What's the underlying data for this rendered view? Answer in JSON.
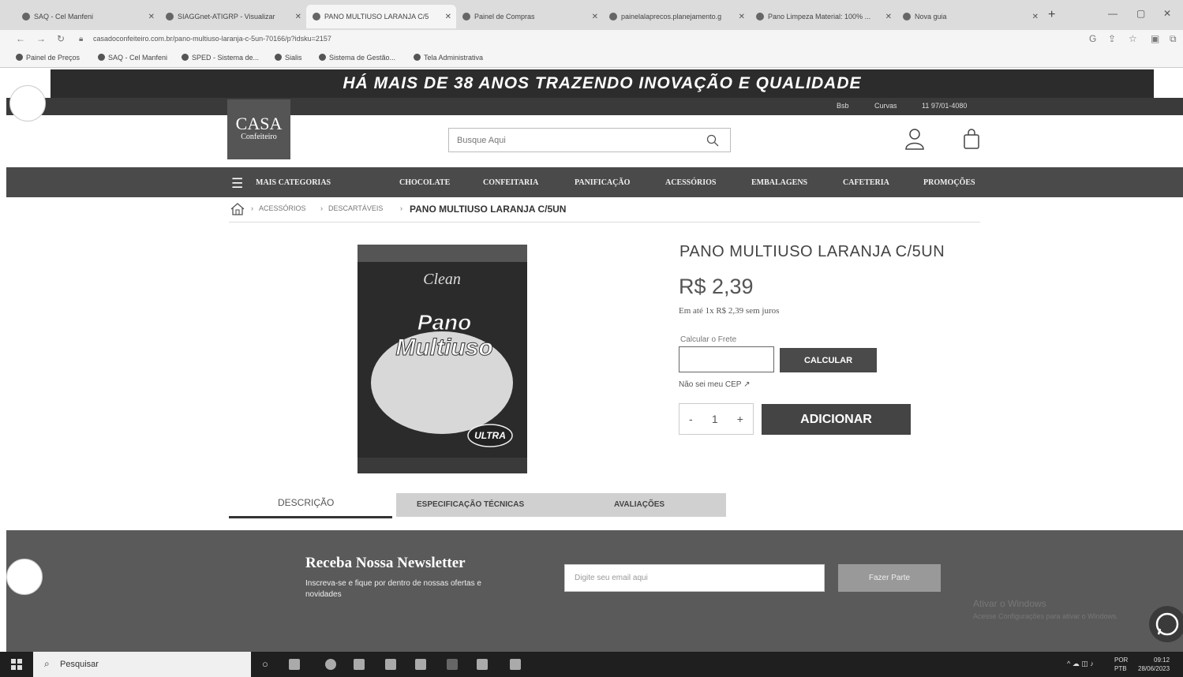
{
  "browser": {
    "tabs": [
      {
        "label": "SAQ - Cel Manfeni",
        "active": false
      },
      {
        "label": "SIAGGnet-ATIGRP - Visualizar",
        "active": false
      },
      {
        "label": "PANO MULTIUSO LARANJA C/5",
        "active": true
      },
      {
        "label": "Painel de Compras",
        "active": false
      },
      {
        "label": "painelalaprecos.planejamento.g",
        "active": false
      },
      {
        "label": "Pano Limpeza Material: 100% ...",
        "active": false
      },
      {
        "label": "Nova guia",
        "active": false
      }
    ],
    "url": "casadoconfeiteiro.com.br/pano-multiuso-laranja-c-5un-70166/p?idsku=2157",
    "bookmarks": [
      "Painel de Preços",
      "SAQ - Cel Manfeni",
      "SPED - Sistema de...",
      "Sialis",
      "Sistema de Gestão...",
      "Tela Administrativa"
    ]
  },
  "site": {
    "banner": "HÁ MAIS DE 38 ANOS TRAZENDO INOVAÇÃO E QUALIDADE",
    "contact": {
      "item1": "Bsb",
      "item2": "Curvas",
      "phone": "11 97/01-4080"
    },
    "logo": {
      "line1": "CASA",
      "line2": "Confeiteiro"
    },
    "search_placeholder": "Busque Aqui",
    "nav": [
      "MAIS CATEGORIAS",
      "CHOCOLATE",
      "CONFEITARIA",
      "PANIFICAÇÃO",
      "ACESSÓRIOS",
      "EMBALAGENS",
      "CAFETERIA",
      "PROMOÇÕES"
    ],
    "breadcrumb": [
      "ACESSÓRIOS",
      "DESCARTÁVEIS",
      "PANO MULTIUSO LARANJA C/5UN"
    ]
  },
  "product": {
    "title": "PANO MULTIUSO LARANJA C/5UN",
    "price": "R$ 2,39",
    "installments": "Em até 1x R$ 2,39 sem juros",
    "freight_label": "Calcular o Frete",
    "calc_button": "CALCULAR",
    "no_cep": "Não sei meu CEP",
    "quantity": "1",
    "qty_minus": "-",
    "qty_plus": "+",
    "add_button": "ADICIONAR",
    "image": {
      "brand": "Clean",
      "name_line1": "Pano",
      "name_line2": "Multiuso",
      "badge": "ULTRA"
    }
  },
  "tabs": [
    "DESCRIÇÃO",
    "ESPECIFICAÇÃO TÉCNICAS",
    "AVALIAÇÕES"
  ],
  "newsletter": {
    "title": "Receba Nossa Newsletter",
    "subtitle": "Inscreva-se e fique por dentro de nossas ofertas e novidades",
    "email_placeholder": "Digite seu email aqui",
    "button": "Fazer Parte"
  },
  "windows": {
    "activate_title": "Ativar o Windows",
    "activate_sub": "Acesse Configurações para ativar o Windows.",
    "search": "Pesquisar",
    "lang": "POR",
    "lang2": "PTB",
    "time": "09:12",
    "date": "28/06/2023"
  }
}
